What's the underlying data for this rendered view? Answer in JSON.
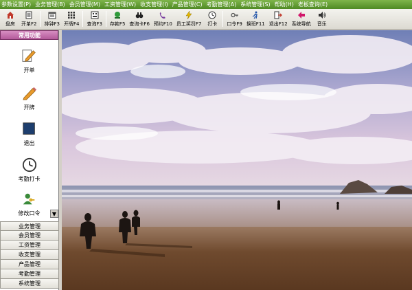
{
  "menu": [
    "参数设置(P)",
    "业务管理(B)",
    "会员管理(M)",
    "工资管理(W)",
    "收支管理(I)",
    "产品管理(C)",
    "考勤管理(A)",
    "系统管理(S)",
    "帮助(H)",
    "老板查询(E)"
  ],
  "toolbar": {
    "groups": [
      [
        {
          "label": "盘房",
          "icon": "house-icon"
        },
        {
          "label": "开单F2",
          "icon": "order-icon"
        }
      ],
      [
        {
          "label": "排钟F3",
          "icon": "schedule-icon"
        },
        {
          "label": "开牌F4",
          "icon": "grid-icon"
        }
      ],
      [
        {
          "label": "查询F3",
          "icon": "query-icon"
        }
      ],
      [
        {
          "label": "存款F5",
          "icon": "deposit-icon"
        },
        {
          "label": "查询卡F6",
          "icon": "binoculars-icon"
        },
        {
          "label": "预约F10",
          "icon": "phone-icon"
        },
        {
          "label": "员工奖罚F7",
          "icon": "lightning-icon"
        },
        {
          "label": "打卡",
          "icon": "clock-icon"
        }
      ],
      [
        {
          "label": "口令F9",
          "icon": "key-icon"
        },
        {
          "label": "换班F11",
          "icon": "runner-icon"
        },
        {
          "label": "退出F12",
          "icon": "exit-icon"
        },
        {
          "label": "系统导航",
          "icon": "nav-icon"
        },
        {
          "label": "音乐",
          "icon": "speaker-icon"
        }
      ]
    ]
  },
  "sidebar": {
    "header": "常用功能",
    "functions": [
      {
        "label": "开单",
        "icon": "pencil-paper-icon"
      },
      {
        "label": "开牌",
        "icon": "pencil-icon"
      },
      {
        "label": "退出",
        "icon": "moon-exit-icon"
      },
      {
        "label": "考勤打卡",
        "icon": "clock-icon"
      },
      {
        "label": "修改口令",
        "icon": "user-key-icon"
      }
    ],
    "categories": [
      "业务管理",
      "会员管理",
      "工资管理",
      "收支管理",
      "产品管理",
      "考勤管理",
      "系统管理"
    ]
  },
  "colors": {
    "menubar": "#5f9a30",
    "sidebar_header": "#c173a9"
  }
}
